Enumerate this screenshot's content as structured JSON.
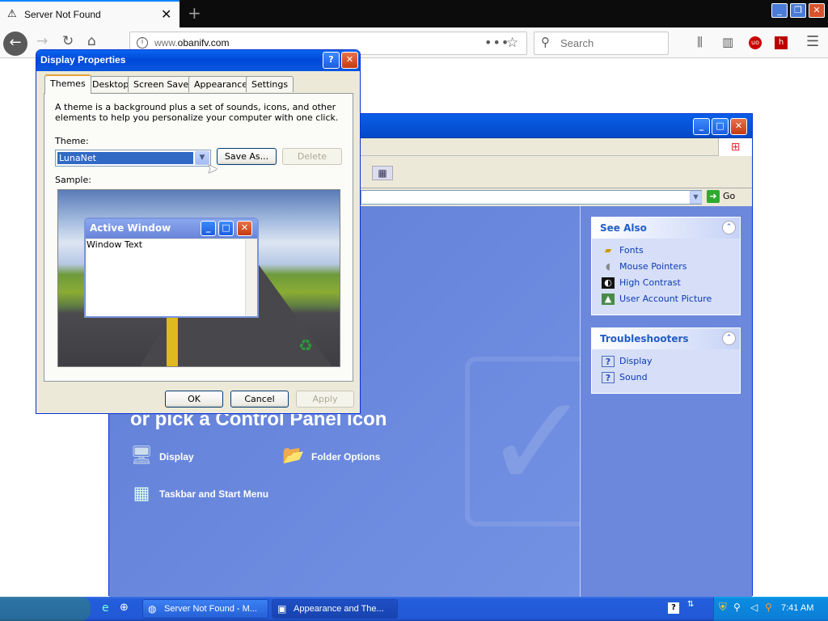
{
  "browser": {
    "tab_title": "Server Not Found",
    "url_prefix": "www.",
    "url_domain": "obanifv.com",
    "search_placeholder": "Search"
  },
  "control_panel": {
    "see_also": {
      "title": "See Also",
      "items": [
        "Fonts",
        "Mouse Pointers",
        "High Contrast",
        "User Account Picture"
      ]
    },
    "troubleshooters": {
      "title": "Troubleshooters",
      "items": [
        "Display",
        "Sound"
      ]
    },
    "go_label": "Go",
    "pick_heading": "or pick a Control Panel icon",
    "icons": [
      "Display",
      "Folder Options",
      "Taskbar and Start Menu"
    ]
  },
  "display_properties": {
    "title": "Display Properties",
    "tabs": [
      "Themes",
      "Desktop",
      "Screen Saver",
      "Appearance",
      "Settings"
    ],
    "active_tab": "Themes",
    "description": "A theme is a background plus a set of sounds, icons, and other elements to help you personalize your computer with one click.",
    "theme_label": "Theme:",
    "theme_value": "LunaNet",
    "save_as": "Save As...",
    "delete": "Delete",
    "sample_label": "Sample:",
    "active_window_title": "Active Window",
    "window_text": "Window Text",
    "ok": "OK",
    "cancel": "Cancel",
    "apply": "Apply"
  },
  "taskbar": {
    "tasks": [
      "Server Not Found - M...",
      "Appearance and The..."
    ],
    "clock": "7:41 AM"
  }
}
